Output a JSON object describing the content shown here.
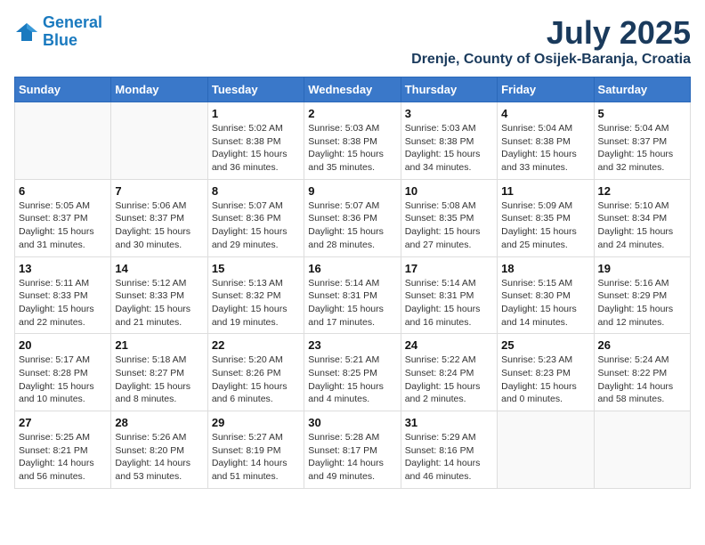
{
  "logo": {
    "line1": "General",
    "line2": "Blue"
  },
  "title": "July 2025",
  "location": "Drenje, County of Osijek-Baranja, Croatia",
  "days_header": [
    "Sunday",
    "Monday",
    "Tuesday",
    "Wednesday",
    "Thursday",
    "Friday",
    "Saturday"
  ],
  "weeks": [
    [
      {
        "day": "",
        "info": ""
      },
      {
        "day": "",
        "info": ""
      },
      {
        "day": "1",
        "info": "Sunrise: 5:02 AM\nSunset: 8:38 PM\nDaylight: 15 hours and 36 minutes."
      },
      {
        "day": "2",
        "info": "Sunrise: 5:03 AM\nSunset: 8:38 PM\nDaylight: 15 hours and 35 minutes."
      },
      {
        "day": "3",
        "info": "Sunrise: 5:03 AM\nSunset: 8:38 PM\nDaylight: 15 hours and 34 minutes."
      },
      {
        "day": "4",
        "info": "Sunrise: 5:04 AM\nSunset: 8:38 PM\nDaylight: 15 hours and 33 minutes."
      },
      {
        "day": "5",
        "info": "Sunrise: 5:04 AM\nSunset: 8:37 PM\nDaylight: 15 hours and 32 minutes."
      }
    ],
    [
      {
        "day": "6",
        "info": "Sunrise: 5:05 AM\nSunset: 8:37 PM\nDaylight: 15 hours and 31 minutes."
      },
      {
        "day": "7",
        "info": "Sunrise: 5:06 AM\nSunset: 8:37 PM\nDaylight: 15 hours and 30 minutes."
      },
      {
        "day": "8",
        "info": "Sunrise: 5:07 AM\nSunset: 8:36 PM\nDaylight: 15 hours and 29 minutes."
      },
      {
        "day": "9",
        "info": "Sunrise: 5:07 AM\nSunset: 8:36 PM\nDaylight: 15 hours and 28 minutes."
      },
      {
        "day": "10",
        "info": "Sunrise: 5:08 AM\nSunset: 8:35 PM\nDaylight: 15 hours and 27 minutes."
      },
      {
        "day": "11",
        "info": "Sunrise: 5:09 AM\nSunset: 8:35 PM\nDaylight: 15 hours and 25 minutes."
      },
      {
        "day": "12",
        "info": "Sunrise: 5:10 AM\nSunset: 8:34 PM\nDaylight: 15 hours and 24 minutes."
      }
    ],
    [
      {
        "day": "13",
        "info": "Sunrise: 5:11 AM\nSunset: 8:33 PM\nDaylight: 15 hours and 22 minutes."
      },
      {
        "day": "14",
        "info": "Sunrise: 5:12 AM\nSunset: 8:33 PM\nDaylight: 15 hours and 21 minutes."
      },
      {
        "day": "15",
        "info": "Sunrise: 5:13 AM\nSunset: 8:32 PM\nDaylight: 15 hours and 19 minutes."
      },
      {
        "day": "16",
        "info": "Sunrise: 5:14 AM\nSunset: 8:31 PM\nDaylight: 15 hours and 17 minutes."
      },
      {
        "day": "17",
        "info": "Sunrise: 5:14 AM\nSunset: 8:31 PM\nDaylight: 15 hours and 16 minutes."
      },
      {
        "day": "18",
        "info": "Sunrise: 5:15 AM\nSunset: 8:30 PM\nDaylight: 15 hours and 14 minutes."
      },
      {
        "day": "19",
        "info": "Sunrise: 5:16 AM\nSunset: 8:29 PM\nDaylight: 15 hours and 12 minutes."
      }
    ],
    [
      {
        "day": "20",
        "info": "Sunrise: 5:17 AM\nSunset: 8:28 PM\nDaylight: 15 hours and 10 minutes."
      },
      {
        "day": "21",
        "info": "Sunrise: 5:18 AM\nSunset: 8:27 PM\nDaylight: 15 hours and 8 minutes."
      },
      {
        "day": "22",
        "info": "Sunrise: 5:20 AM\nSunset: 8:26 PM\nDaylight: 15 hours and 6 minutes."
      },
      {
        "day": "23",
        "info": "Sunrise: 5:21 AM\nSunset: 8:25 PM\nDaylight: 15 hours and 4 minutes."
      },
      {
        "day": "24",
        "info": "Sunrise: 5:22 AM\nSunset: 8:24 PM\nDaylight: 15 hours and 2 minutes."
      },
      {
        "day": "25",
        "info": "Sunrise: 5:23 AM\nSunset: 8:23 PM\nDaylight: 15 hours and 0 minutes."
      },
      {
        "day": "26",
        "info": "Sunrise: 5:24 AM\nSunset: 8:22 PM\nDaylight: 14 hours and 58 minutes."
      }
    ],
    [
      {
        "day": "27",
        "info": "Sunrise: 5:25 AM\nSunset: 8:21 PM\nDaylight: 14 hours and 56 minutes."
      },
      {
        "day": "28",
        "info": "Sunrise: 5:26 AM\nSunset: 8:20 PM\nDaylight: 14 hours and 53 minutes."
      },
      {
        "day": "29",
        "info": "Sunrise: 5:27 AM\nSunset: 8:19 PM\nDaylight: 14 hours and 51 minutes."
      },
      {
        "day": "30",
        "info": "Sunrise: 5:28 AM\nSunset: 8:17 PM\nDaylight: 14 hours and 49 minutes."
      },
      {
        "day": "31",
        "info": "Sunrise: 5:29 AM\nSunset: 8:16 PM\nDaylight: 14 hours and 46 minutes."
      },
      {
        "day": "",
        "info": ""
      },
      {
        "day": "",
        "info": ""
      }
    ]
  ]
}
